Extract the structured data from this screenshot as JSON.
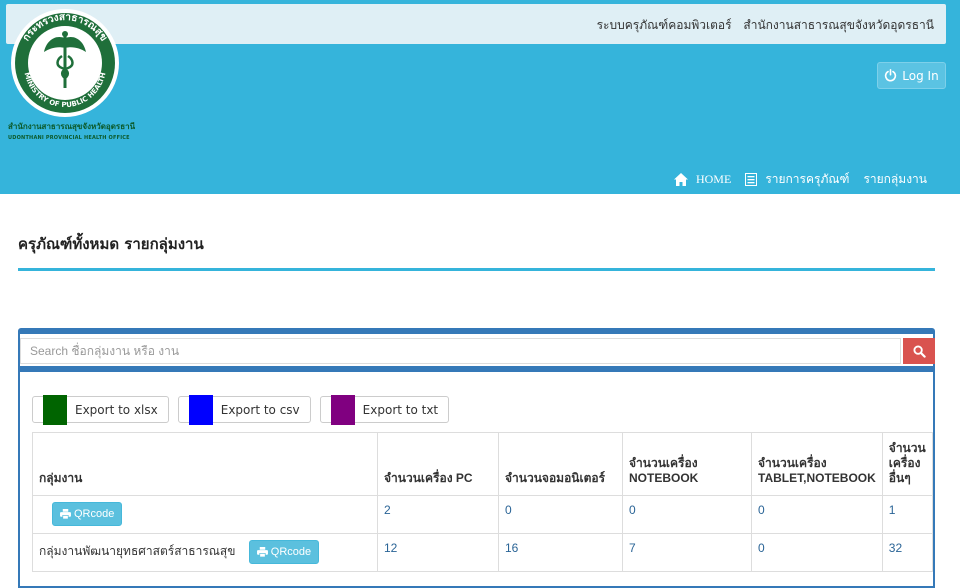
{
  "topbar": {
    "system_name": "ระบบครุภัณฑ์คอมพิวเตอร์",
    "office_name": "สำนักงานสาธารณสุขจังหวัดอุดรธานี"
  },
  "logo": {
    "ring_top": "กระทรวงสาธารณสุข",
    "ring_bottom": "MINISTRY OF PUBLIC HEALTH",
    "caption_thai": "สำนักงานสาธารณสุขจังหวัดอุดรธานี",
    "caption_eng": "UDONTHANI PROVINCIAL HEALTH OFFICE"
  },
  "login": {
    "label": "Log In"
  },
  "nav": {
    "home": "HOME",
    "items": [
      "รายการครุภัณฑ์",
      "รายกลุ่มงาน"
    ]
  },
  "page_title": "ครุภัณฑ์ทั้งหมด รายกลุ่มงาน",
  "search": {
    "placeholder": "Search ชื่อกลุ่มงาน หรือ งาน"
  },
  "exports": [
    {
      "label": "Export to xlsx",
      "color": "#006400"
    },
    {
      "label": "Export to csv",
      "color": "#0000ff"
    },
    {
      "label": "Export to txt",
      "color": "#800080"
    }
  ],
  "table": {
    "headers": [
      "กลุ่มงาน",
      "จำนวนเครื่อง PC",
      "จำนวนจอมอนิเตอร์",
      "จำนวนเครื่อง NOTEBOOK",
      "จำนวนเครื่อง TABLET,NOTEBOOK",
      "จำนวน เครื่อง อื่นๆ"
    ],
    "qr_label": "QRcode",
    "rows": [
      {
        "name": "",
        "pc": "2",
        "monitor": "0",
        "notebook": "0",
        "tablet": "0",
        "other": "1"
      },
      {
        "name": "กลุ่มงานพัฒนายุทธศาสตร์สาธารณสุข",
        "pc": "12",
        "monitor": "16",
        "notebook": "7",
        "tablet": "0",
        "other": "32"
      }
    ]
  }
}
